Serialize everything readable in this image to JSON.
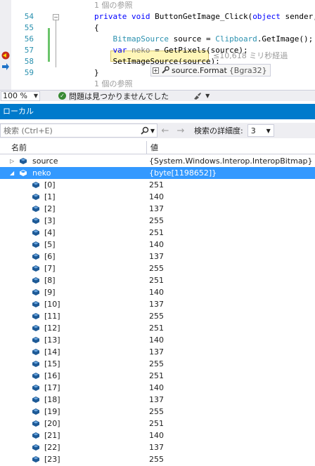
{
  "editor": {
    "lines": [
      {
        "num": "",
        "parts": [
          {
            "t": "1 個の参照",
            "c": "cl"
          }
        ]
      },
      {
        "num": "54",
        "parts": [
          {
            "t": "private ",
            "c": "kw"
          },
          {
            "t": "void ",
            "c": "kw"
          },
          {
            "t": "ButtonGetImage_Click(",
            "c": ""
          },
          {
            "t": "object ",
            "c": "kw"
          },
          {
            "t": "sender, Rout",
            "c": ""
          }
        ]
      },
      {
        "num": "55",
        "parts": [
          {
            "t": "{",
            "c": ""
          }
        ]
      },
      {
        "num": "56",
        "parts": [
          {
            "t": "    ",
            "c": ""
          },
          {
            "t": "BitmapSource ",
            "c": "ty"
          },
          {
            "t": "source = ",
            "c": ""
          },
          {
            "t": "Clipboard",
            "c": "ty"
          },
          {
            "t": ".GetImage();",
            "c": ""
          }
        ]
      },
      {
        "num": "57",
        "parts": [
          {
            "t": "    ",
            "c": ""
          },
          {
            "t": "var ",
            "c": "kw"
          },
          {
            "t": "neko",
            "c": "mu"
          },
          {
            "t": " = GetPixels(source);",
            "c": ""
          }
        ]
      },
      {
        "num": "58",
        "parts": [
          {
            "t": "    SetImageSource(source);",
            "c": ""
          }
        ]
      },
      {
        "num": "59",
        "parts": [
          {
            "t": "}",
            "c": ""
          }
        ]
      },
      {
        "num": "",
        "parts": [
          {
            "t": "1 個の参照",
            "c": "cl"
          }
        ]
      }
    ],
    "perf_tip": "≤10,618 ミリ秒経過",
    "datatip": {
      "expr": "source.Format",
      "value": "{Bgra32}"
    }
  },
  "status_bar": {
    "zoom": "100 %",
    "issues_text": "問題は見つかりませんでした"
  },
  "locals": {
    "title": "ローカル",
    "search_placeholder": "検索 (Ctrl+E)",
    "depth_label": "検索の詳細度:",
    "depth_value": "3",
    "columns": {
      "name": "名前",
      "value": "値"
    },
    "rows": [
      {
        "name": "source",
        "value": "{System.Windows.Interop.InteropBitmap}",
        "level": 0,
        "expander": "right",
        "selected": false
      },
      {
        "name": "neko",
        "value": "{byte[1198652]}",
        "level": 0,
        "expander": "down",
        "selected": true
      },
      {
        "name": "[0]",
        "value": "251",
        "level": 1
      },
      {
        "name": "[1]",
        "value": "140",
        "level": 1
      },
      {
        "name": "[2]",
        "value": "137",
        "level": 1
      },
      {
        "name": "[3]",
        "value": "255",
        "level": 1
      },
      {
        "name": "[4]",
        "value": "251",
        "level": 1
      },
      {
        "name": "[5]",
        "value": "140",
        "level": 1
      },
      {
        "name": "[6]",
        "value": "137",
        "level": 1
      },
      {
        "name": "[7]",
        "value": "255",
        "level": 1
      },
      {
        "name": "[8]",
        "value": "251",
        "level": 1
      },
      {
        "name": "[9]",
        "value": "140",
        "level": 1
      },
      {
        "name": "[10]",
        "value": "137",
        "level": 1
      },
      {
        "name": "[11]",
        "value": "255",
        "level": 1
      },
      {
        "name": "[12]",
        "value": "251",
        "level": 1
      },
      {
        "name": "[13]",
        "value": "140",
        "level": 1
      },
      {
        "name": "[14]",
        "value": "137",
        "level": 1
      },
      {
        "name": "[15]",
        "value": "255",
        "level": 1
      },
      {
        "name": "[16]",
        "value": "251",
        "level": 1
      },
      {
        "name": "[17]",
        "value": "140",
        "level": 1
      },
      {
        "name": "[18]",
        "value": "137",
        "level": 1
      },
      {
        "name": "[19]",
        "value": "255",
        "level": 1
      },
      {
        "name": "[20]",
        "value": "251",
        "level": 1
      },
      {
        "name": "[21]",
        "value": "140",
        "level": 1
      },
      {
        "name": "[22]",
        "value": "137",
        "level": 1
      },
      {
        "name": "[23]",
        "value": "255",
        "level": 1
      }
    ]
  },
  "colors": {
    "accent": "#007acc",
    "selection": "#3399ff",
    "keyword": "#0000ff",
    "type": "#2b91af",
    "object_icon": "#1e5a96"
  }
}
